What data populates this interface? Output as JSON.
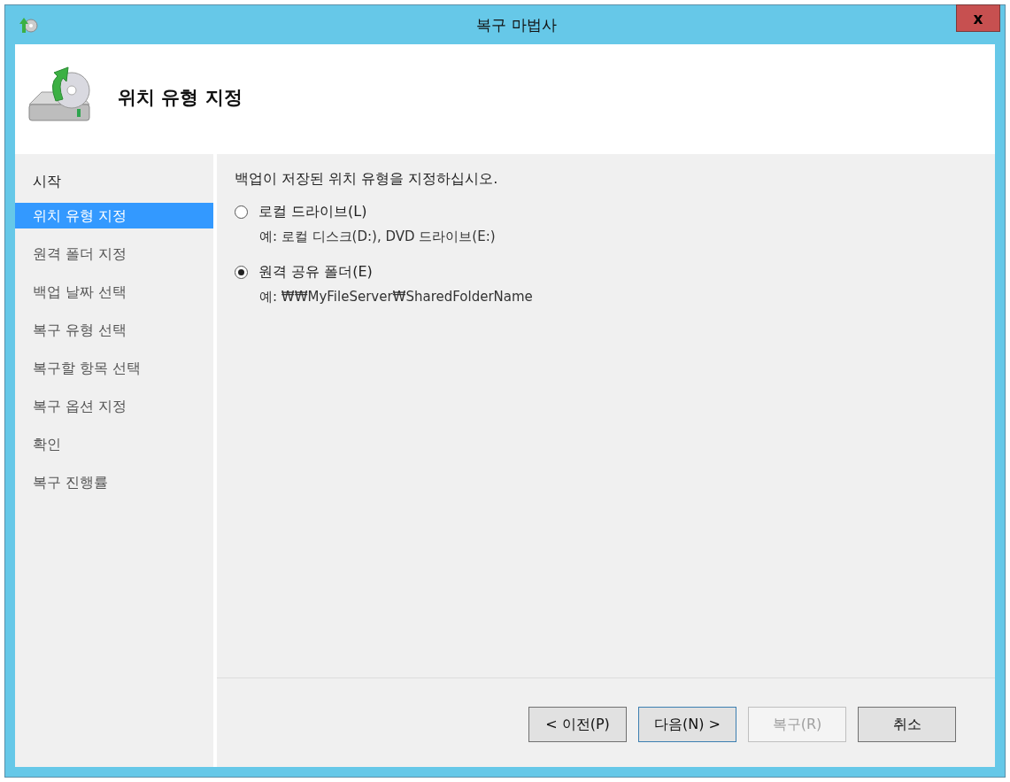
{
  "window": {
    "title": "복구 마법사",
    "close_label": "x"
  },
  "header": {
    "title": "위치 유형 지정"
  },
  "steps": [
    {
      "label": "시작",
      "selected": false
    },
    {
      "label": "위치 유형 지정",
      "selected": true
    },
    {
      "label": "원격 폴더 지정",
      "selected": false
    },
    {
      "label": "백업 날짜 선택",
      "selected": false
    },
    {
      "label": "복구 유형 선택",
      "selected": false
    },
    {
      "label": "복구할 항목 선택",
      "selected": false
    },
    {
      "label": "복구 옵션 지정",
      "selected": false
    },
    {
      "label": "확인",
      "selected": false
    },
    {
      "label": "복구 진행률",
      "selected": false
    }
  ],
  "prompt": "백업이 저장된 위치 유형을 지정하십시오.",
  "options": [
    {
      "label": "로컬 드라이브(L)",
      "example": "예: 로컬 디스크(D:), DVD 드라이브(E:)",
      "selected": false
    },
    {
      "label": "원격 공유 폴더(E)",
      "example": "예: ₩₩MyFileServer₩SharedFolderName",
      "selected": true
    }
  ],
  "buttons": [
    {
      "label": "< 이전(P)",
      "disabled": false,
      "focused": false
    },
    {
      "label": "다음(N) >",
      "disabled": false,
      "focused": true
    },
    {
      "label": "복구(R)",
      "disabled": true,
      "focused": false
    },
    {
      "label": "취소",
      "disabled": false,
      "focused": false
    }
  ]
}
